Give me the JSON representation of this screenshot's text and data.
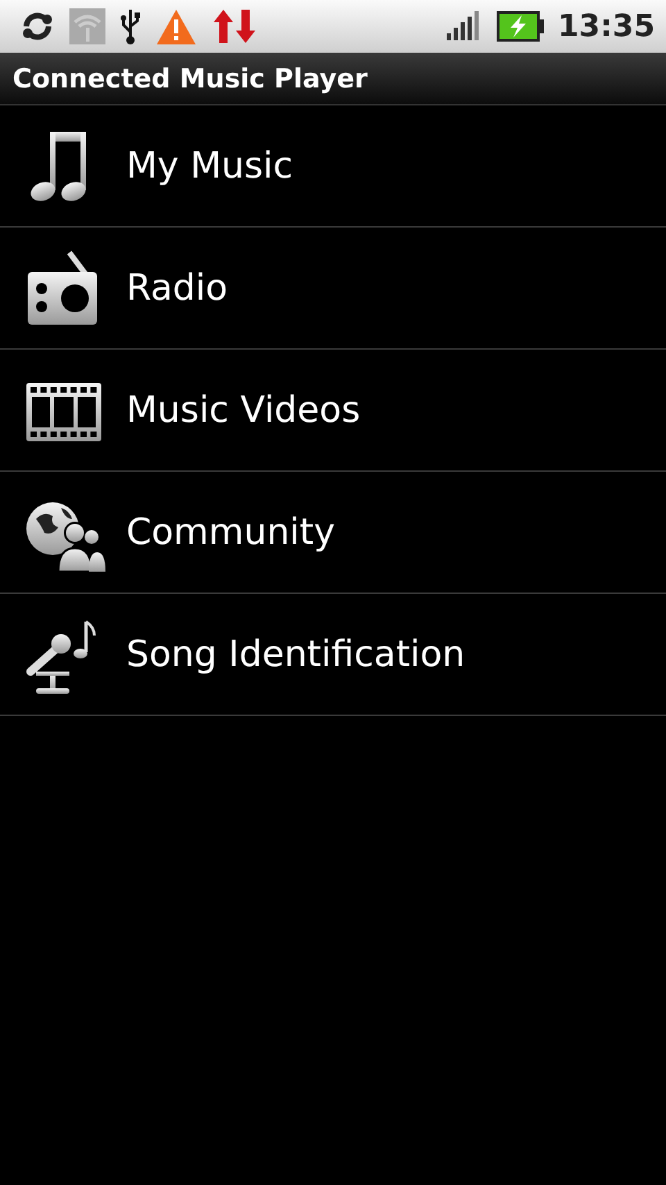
{
  "status_bar": {
    "time": "13:35"
  },
  "title": "Connected Music Player",
  "items": [
    {
      "label": "My Music",
      "kind": "music"
    },
    {
      "label": "Radio",
      "kind": "radio"
    },
    {
      "label": "Music Videos",
      "kind": "video"
    },
    {
      "label": "Community",
      "kind": "community"
    },
    {
      "label": "Song Identification",
      "kind": "songid"
    }
  ]
}
